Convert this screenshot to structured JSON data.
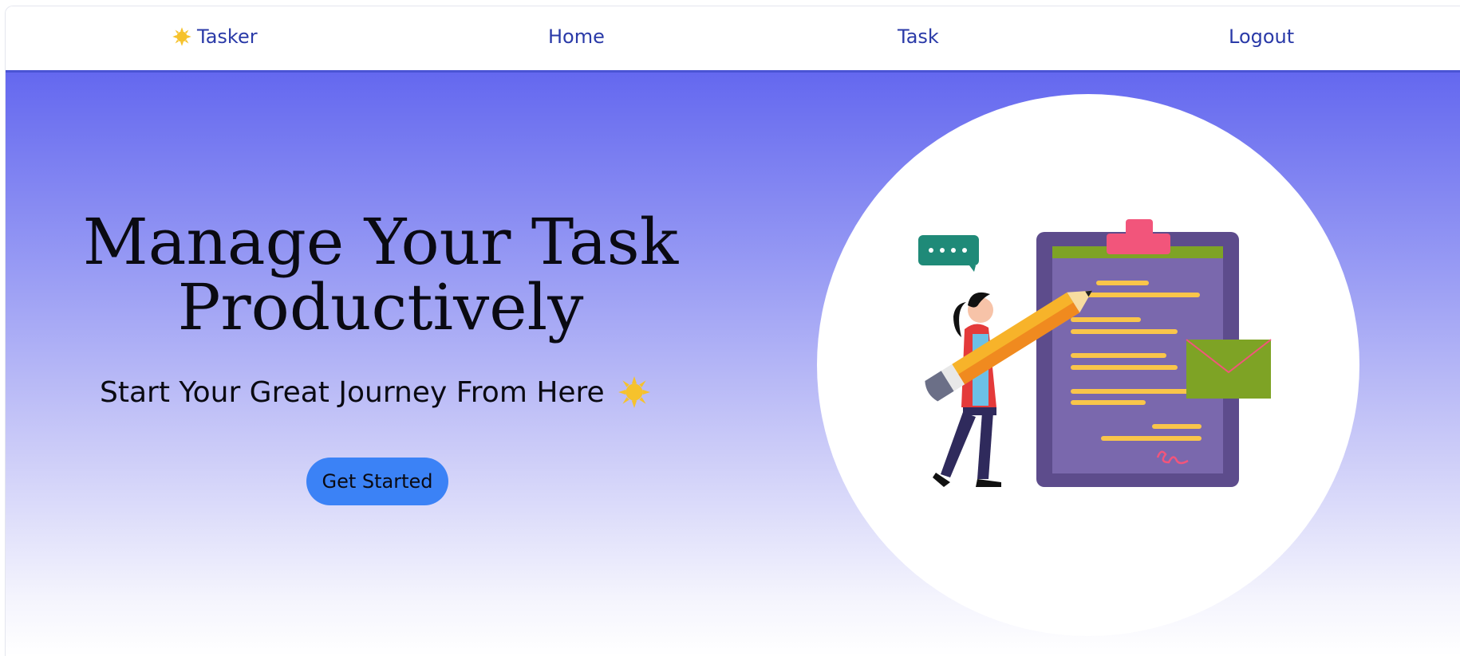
{
  "navbar": {
    "brand_label": "Tasker",
    "brand_icon": "sun-icon",
    "links": {
      "home": "Home",
      "task": "Task",
      "logout": "Logout"
    }
  },
  "hero": {
    "headline_line1": "Manage Your Task",
    "headline_line2": "Productively",
    "subheadline": "Start Your Great Journey From Here",
    "subheadline_icon": "sun-icon",
    "cta_label": "Get Started",
    "illustration": "woman-with-pencil-and-clipboard-illustration"
  },
  "colors": {
    "nav_text": "#2a3aa8",
    "nav_border": "#4a54d4",
    "hero_gradient_top": "#6468ef",
    "cta_background": "#3b82f6"
  }
}
